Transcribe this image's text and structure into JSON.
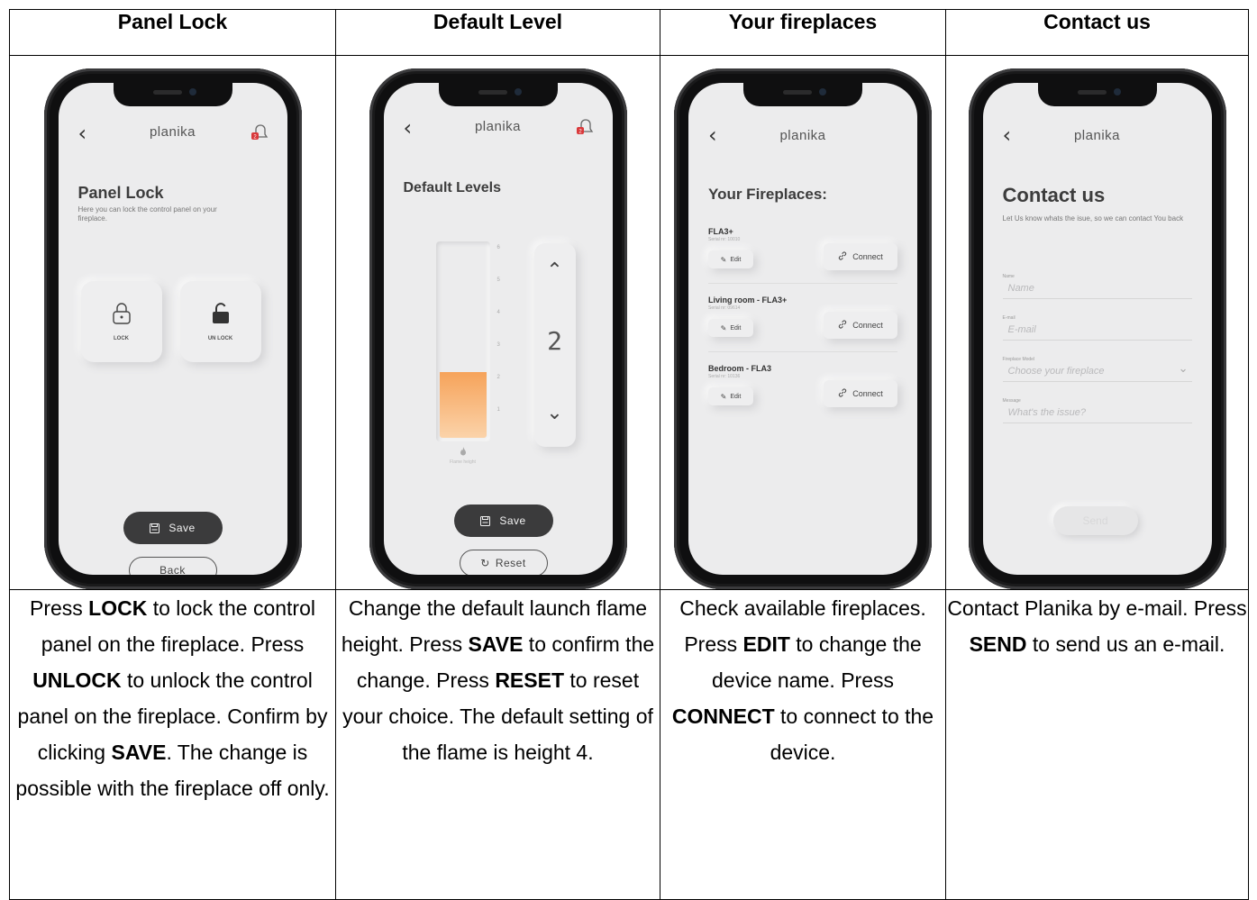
{
  "headers": [
    "Panel Lock",
    "Default Level",
    "Your fireplaces",
    "Contact us"
  ],
  "brand": "planika",
  "icons": {
    "back": "chevron-left-icon",
    "bell": "bell-icon",
    "lock": "lock-icon",
    "unlock": "unlock-icon",
    "save": "floppy-disk-icon",
    "reset": "reset-icon",
    "edit": "edit-icon",
    "connect": "link-icon",
    "flame": "flame-icon"
  },
  "notification_count": "2",
  "panel_lock": {
    "title": "Panel Lock",
    "subtitle": "Here you can lock the control panel on your fireplace.",
    "lock_label": "LOCK",
    "unlock_label": "UN LOCK",
    "save_label": "Save",
    "back_label": "Back"
  },
  "default_level": {
    "title": "Default Levels",
    "ticks": [
      "6",
      "5",
      "4",
      "3",
      "2",
      "1"
    ],
    "value": "2",
    "level_fraction": 0.34,
    "gauge_caption": "Flame height",
    "save_label": "Save",
    "reset_label": "Reset"
  },
  "fireplaces": {
    "title": "Your Fireplaces:",
    "edit_label": "Edit",
    "connect_label": "Connect",
    "items": [
      {
        "name": "FLA3+",
        "serial": "Serial nr: 10010"
      },
      {
        "name": "Living room - FLA3+",
        "serial": "Serial nr: 09614"
      },
      {
        "name": "Bedroom - FLA3",
        "serial": "Serial nr: 10136"
      }
    ]
  },
  "contact": {
    "title": "Contact us",
    "subtitle": "Let Us know whats the isue, so we can contact You back",
    "fields": [
      {
        "label": "Name",
        "placeholder": "Name"
      },
      {
        "label": "E-mail",
        "placeholder": "E-mail"
      },
      {
        "label": "Fireplace Model",
        "placeholder": "Choose your fireplace"
      },
      {
        "label": "Message",
        "placeholder": "What's the issue?"
      }
    ],
    "send_label": "Send"
  },
  "descriptions": {
    "c1": {
      "t1": "Press ",
      "b1": "LOCK",
      "t2": " to lock the control panel on the fireplace. Press ",
      "b2": "UNLOCK",
      "t3": " to unlock the control panel on the fireplace. Confirm by clicking ",
      "b3": "SAVE",
      "t4": ". The change is possible with the fireplace off only."
    },
    "c2": {
      "t1": "Change the default launch flame height. Press ",
      "b1": "SAVE",
      "t2": " to confirm the change. Press ",
      "b2": "RESET",
      "t3": " to reset your choice. The default setting of the flame is height 4."
    },
    "c3": {
      "t1": "Check available fireplaces. Press ",
      "b1": "EDIT",
      "t2": " to change the device name. Press ",
      "b2": "CONNECT",
      "t3": " to connect to the device."
    },
    "c4": {
      "t1": "Contact Planika by e-mail. Press ",
      "b1": "SEND",
      "t2": " to send us an e-mail."
    }
  }
}
